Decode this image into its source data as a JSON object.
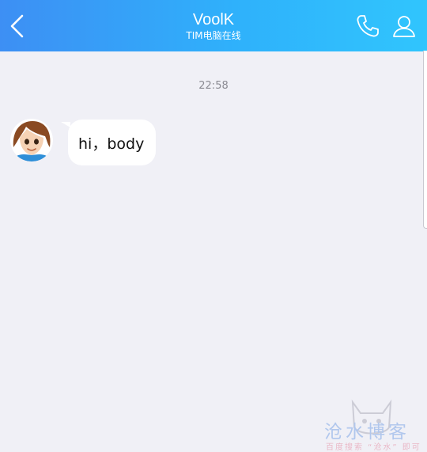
{
  "header": {
    "title": "VoolK",
    "subtitle": "TIM电脑在线",
    "back_icon": "chevron-left-icon",
    "call_icon": "phone-icon",
    "profile_icon": "user-icon",
    "colors": {
      "gradient_start": "#3d8ff4",
      "gradient_end": "#30c5fd"
    }
  },
  "chat": {
    "timestamp": "22:58",
    "messages": [
      {
        "sender": "other",
        "avatar": "cartoon-avatar",
        "text": "hi，body"
      }
    ]
  },
  "watermark": {
    "main": "沧水博客",
    "sub": "百度搜索 “沧水” 即可"
  }
}
